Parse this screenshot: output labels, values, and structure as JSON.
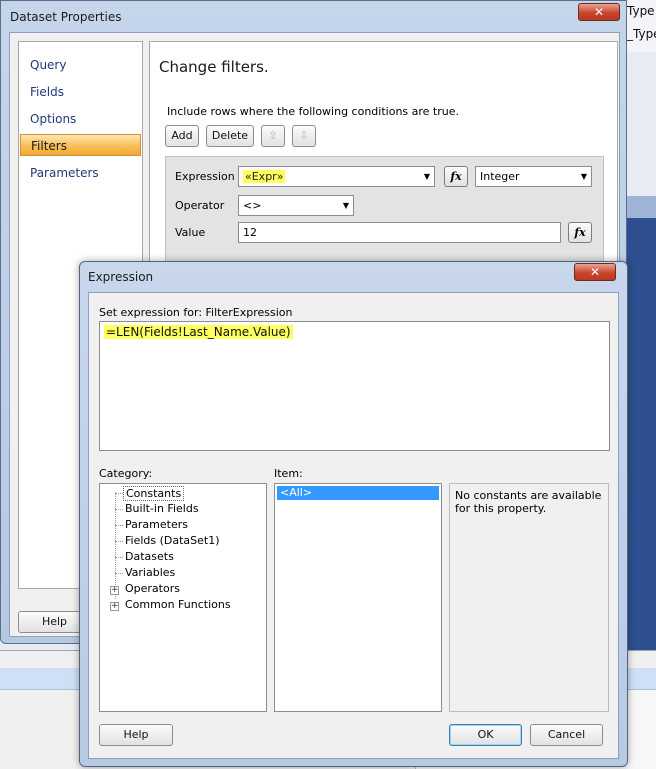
{
  "background": {
    "right_texts": [
      "Type",
      "_Type"
    ]
  },
  "dataset_window": {
    "title": "Dataset Properties",
    "close_glyph": "✕",
    "nav": [
      {
        "label": "Query",
        "selected": false
      },
      {
        "label": "Fields",
        "selected": false
      },
      {
        "label": "Options",
        "selected": false
      },
      {
        "label": "Filters",
        "selected": true
      },
      {
        "label": "Parameters",
        "selected": false
      }
    ],
    "heading": "Change filters.",
    "instruction": "Include rows where the following conditions are true.",
    "buttons": {
      "add": "Add",
      "delete": "Delete",
      "move_up": "⇧",
      "move_down": "⇩"
    },
    "filter": {
      "expression_label": "Expression",
      "expression_value": "«Expr»",
      "type_value": "Integer",
      "operator_label": "Operator",
      "operator_value": "<>",
      "value_label": "Value",
      "value_value": "12",
      "fx_glyph": "fx"
    },
    "help": "Help"
  },
  "expression_dialog": {
    "title": "Expression",
    "close_glyph": "✕",
    "set_label": "Set expression for: FilterExpression",
    "expression": "=LEN(Fields!Last_Name.Value)",
    "category_label": "Category:",
    "item_label": "Item:",
    "categories": [
      {
        "label": "Constants",
        "selected": true,
        "expandable": false
      },
      {
        "label": "Built-in Fields",
        "selected": false,
        "expandable": false
      },
      {
        "label": "Parameters",
        "selected": false,
        "expandable": false
      },
      {
        "label": "Fields (DataSet1)",
        "selected": false,
        "expandable": false
      },
      {
        "label": "Datasets",
        "selected": false,
        "expandable": false
      },
      {
        "label": "Variables",
        "selected": false,
        "expandable": false
      },
      {
        "label": "Operators",
        "selected": false,
        "expandable": true
      },
      {
        "label": "Common Functions",
        "selected": false,
        "expandable": true
      }
    ],
    "expander_glyph": "+",
    "items": [
      "<All>"
    ],
    "description": "No constants are available for this property.",
    "help": "Help",
    "ok": "OK",
    "cancel": "Cancel"
  },
  "colors": {
    "highlight_yellow": "#ffff5e",
    "selection_blue": "#3399ff",
    "nav_selected": "#f8c15c",
    "close_red": "#c9462d"
  }
}
